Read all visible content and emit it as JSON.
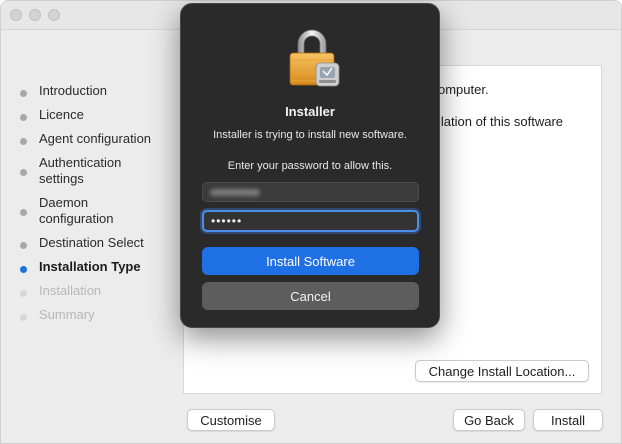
{
  "steps": [
    {
      "label": "Introduction",
      "state": "done"
    },
    {
      "label": "Licence",
      "state": "done"
    },
    {
      "label": "Agent configuration",
      "state": "done"
    },
    {
      "label": "Authentication settings",
      "line1": "Authentication",
      "line2": "settings",
      "state": "done"
    },
    {
      "label": "Daemon configuration",
      "line1": "Daemon",
      "line2": "configuration",
      "state": "done"
    },
    {
      "label": "Destination Select",
      "state": "done"
    },
    {
      "label": "Installation Type",
      "state": "active"
    },
    {
      "label": "Installation",
      "state": "future"
    },
    {
      "label": "Summary",
      "state": "future"
    }
  ],
  "content": {
    "line1": "omputer.",
    "line2": "llation of this software",
    "change_location_label": "Change Install Location..."
  },
  "buttons": {
    "customise": "Customise",
    "go_back": "Go Back",
    "install": "Install"
  },
  "dialog": {
    "title": "Installer",
    "message": "Installer is trying to install new software.",
    "prompt": "Enter your password to allow this.",
    "password_value": "••••••",
    "install_software_label": "Install Software",
    "cancel_label": "Cancel",
    "icon": "lock-icon"
  },
  "colors": {
    "accent": "#1d6fe0",
    "dialog_bg": "#2a2a2a",
    "primary_button": "#1f6fe5",
    "secondary_button": "#5d5d5d"
  }
}
